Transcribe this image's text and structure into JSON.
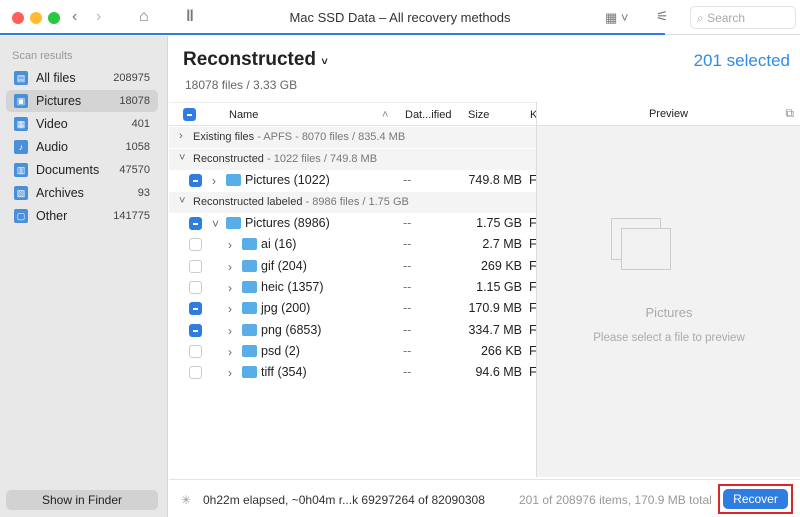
{
  "window": {
    "title": "Mac SSD Data – All recovery methods",
    "search_placeholder": "Search",
    "scan_progress_percent": 84
  },
  "sidebar": {
    "heading": "Scan results",
    "items": [
      {
        "label": "All files",
        "count": "208975",
        "icon": "all-files-icon"
      },
      {
        "label": "Pictures",
        "count": "18078",
        "icon": "pictures-icon",
        "active": true
      },
      {
        "label": "Video",
        "count": "401",
        "icon": "video-icon"
      },
      {
        "label": "Audio",
        "count": "1058",
        "icon": "audio-icon"
      },
      {
        "label": "Documents",
        "count": "47570",
        "icon": "documents-icon"
      },
      {
        "label": "Archives",
        "count": "93",
        "icon": "archives-icon"
      },
      {
        "label": "Other",
        "count": "141775",
        "icon": "other-icon"
      }
    ],
    "show_in_finder": "Show in Finder"
  },
  "main": {
    "title": "Reconstructed",
    "subtitle": "18078 files / 3.33 GB",
    "selected": "201 selected",
    "columns": {
      "name": "Name",
      "date": "Dat...ified",
      "size": "Size",
      "kind": "K"
    },
    "groups": [
      {
        "name": "Existing files",
        "meta": " - APFS - 8070 files / 835.4 MB"
      },
      {
        "name": "Reconstructed",
        "meta": " - 1022 files / 749.8 MB"
      },
      {
        "name": "Reconstructed labeled",
        "meta": " - 8986 files / 1.75 GB"
      }
    ],
    "rows": [
      {
        "name": "Pictures (1022)",
        "date": "--",
        "size": "749.8 MB",
        "kind": "F",
        "checked": true
      },
      {
        "name": "Pictures (8986)",
        "date": "--",
        "size": "1.75 GB",
        "kind": "F",
        "checked": true
      },
      {
        "name": "ai (16)",
        "date": "--",
        "size": "2.7 MB",
        "kind": "F",
        "checked": false
      },
      {
        "name": "gif (204)",
        "date": "--",
        "size": "269 KB",
        "kind": "F",
        "checked": false
      },
      {
        "name": "heic (1357)",
        "date": "--",
        "size": "1.15 GB",
        "kind": "F",
        "checked": false
      },
      {
        "name": "jpg (200)",
        "date": "--",
        "size": "170.9 MB",
        "kind": "F",
        "checked": true
      },
      {
        "name": "png (6853)",
        "date": "--",
        "size": "334.7 MB",
        "kind": "F",
        "checked": true
      },
      {
        "name": "psd (2)",
        "date": "--",
        "size": "266 KB",
        "kind": "F",
        "checked": false
      },
      {
        "name": "tiff (354)",
        "date": "--",
        "size": "94.6 MB",
        "kind": "F",
        "checked": false
      }
    ]
  },
  "preview": {
    "header": "Preview",
    "title": "Pictures",
    "hint": "Please select a file to preview"
  },
  "status": {
    "progress": "0h22m elapsed, ~0h04m r...k 69297264 of 82090308",
    "summary": "201 of 208976 items, 170.9 MB total",
    "recover": "Recover"
  }
}
